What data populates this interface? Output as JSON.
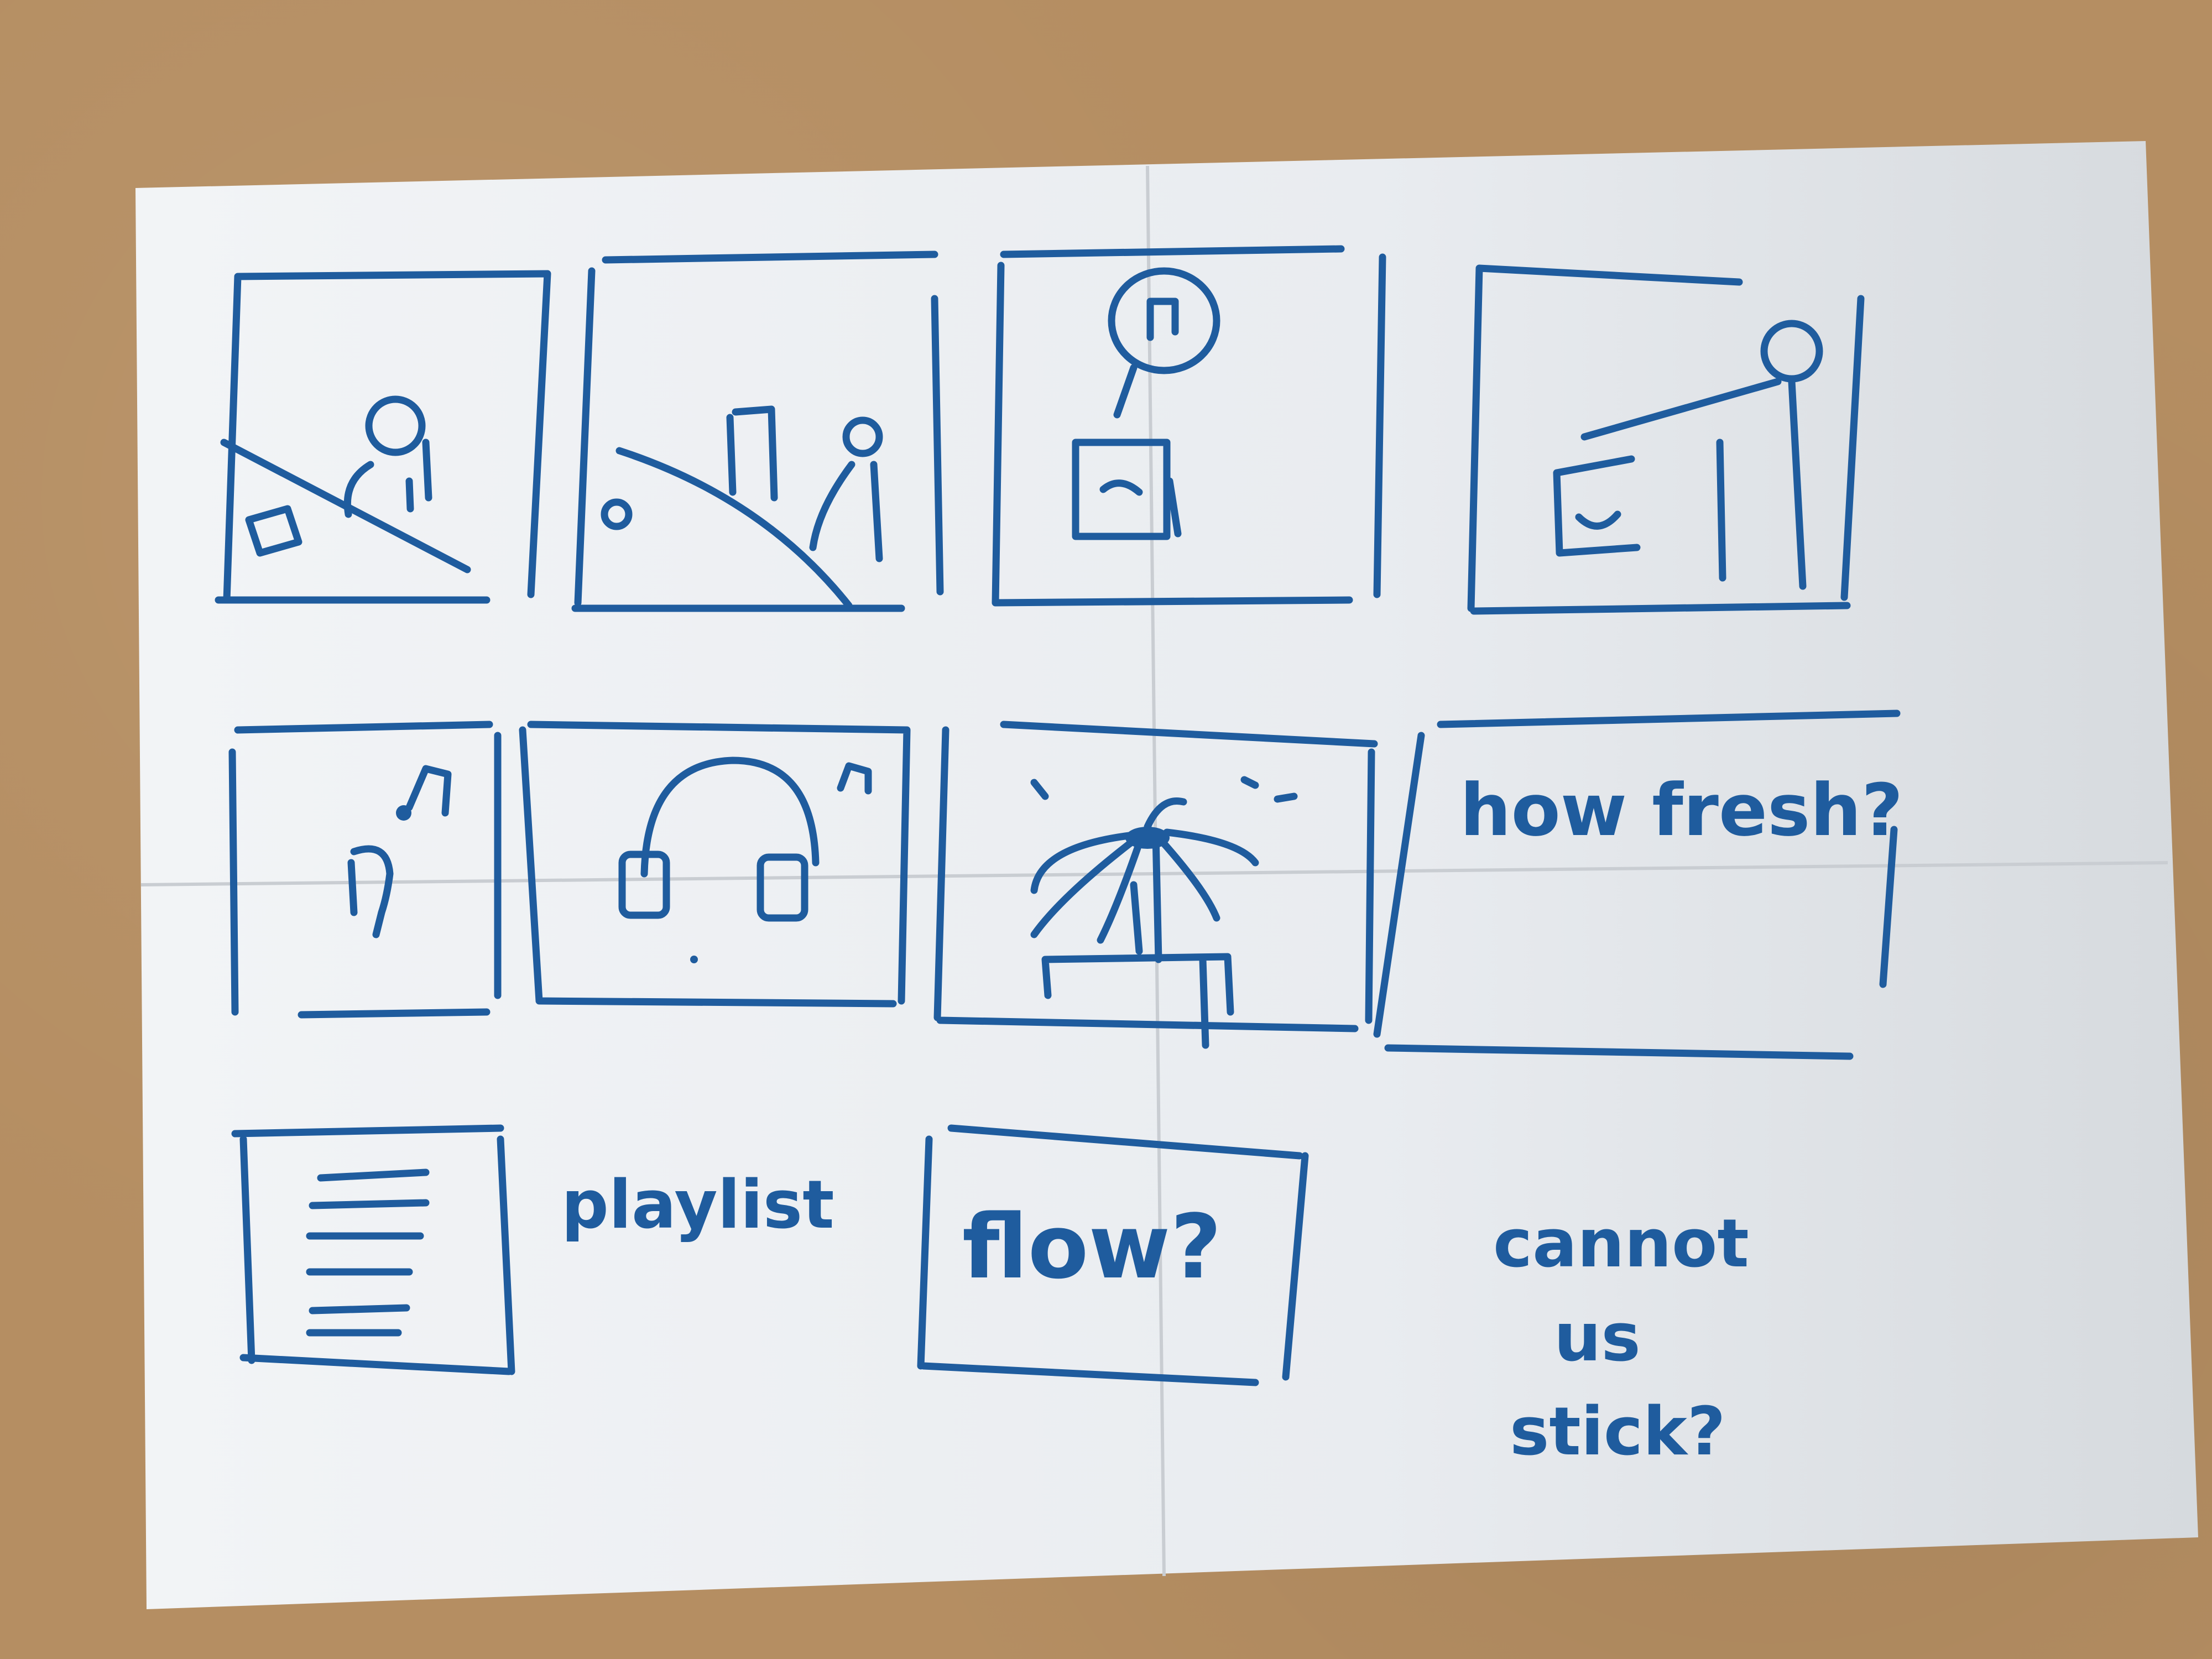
{
  "image": {
    "description_colors": {
      "background": "#b58e62",
      "paper": "#eef0f3",
      "ink": "#1f5c9e"
    }
  },
  "notes": {
    "label_1": "how fresh?",
    "label_2": "playlist",
    "label_3": "flow?",
    "label_4_line1": "cannot",
    "label_4_line2": "us",
    "label_4_line3": "stick?"
  },
  "frames": [
    {
      "icon": "desk-person-box-icon"
    },
    {
      "icon": "desk-laptop-person-icon"
    },
    {
      "icon": "sad-screen-music-bubble-icon"
    },
    {
      "icon": "happy-screen-person-icon"
    },
    {
      "icon": "ear-music-icon"
    },
    {
      "icon": "headphones-music-icon"
    },
    {
      "icon": "plant-on-table-icon"
    },
    {
      "icon": "note-frame-icon"
    },
    {
      "icon": "playlist-lines-icon"
    },
    {
      "icon": "flow-frame-icon"
    }
  ]
}
